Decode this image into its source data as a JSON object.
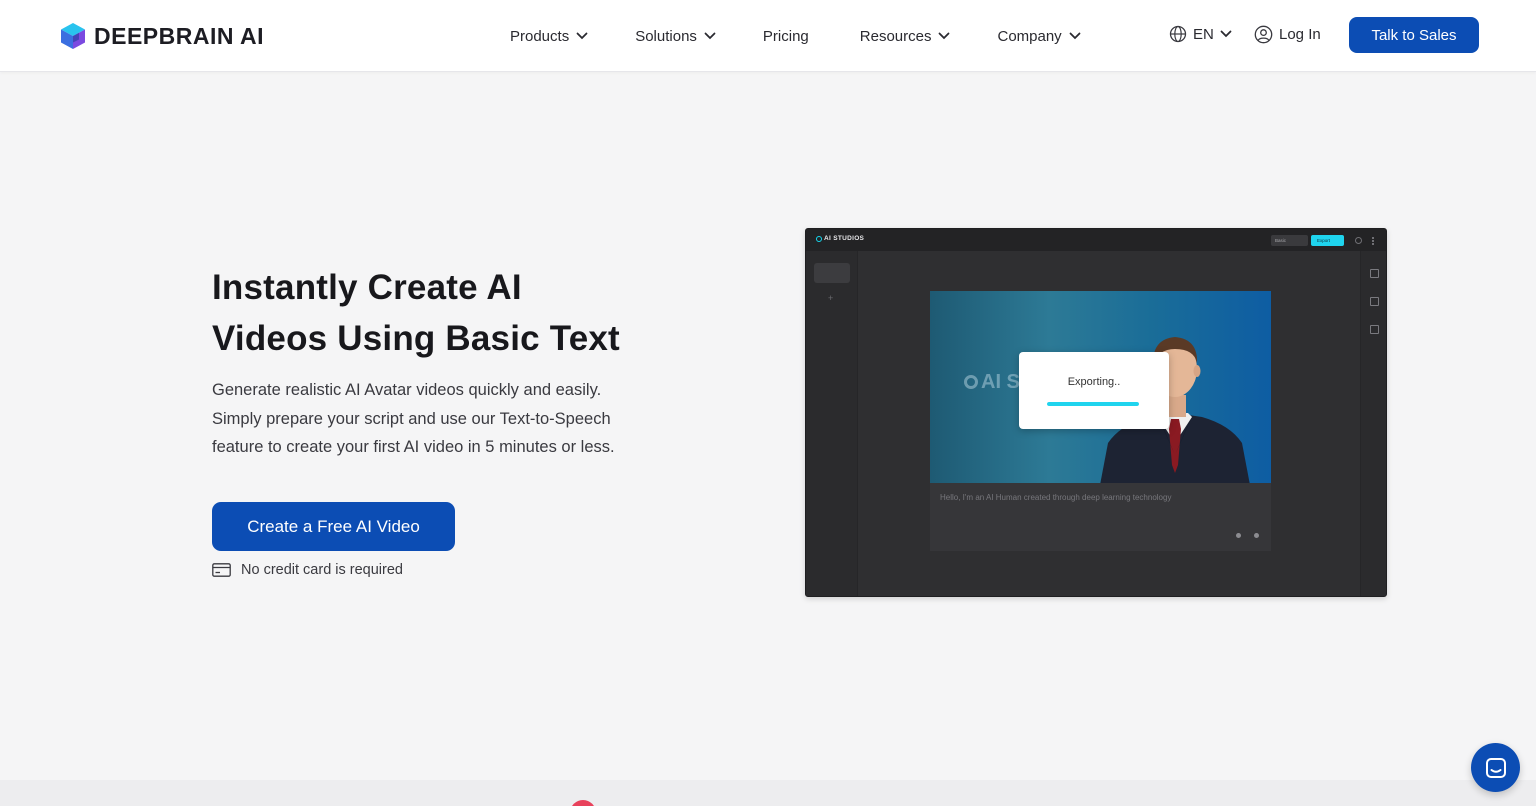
{
  "brand": {
    "name": "DEEPBRAIN AI"
  },
  "nav": {
    "items": [
      {
        "label": "Products",
        "has_dropdown": true
      },
      {
        "label": "Solutions",
        "has_dropdown": true
      },
      {
        "label": "Pricing",
        "has_dropdown": false
      },
      {
        "label": "Resources",
        "has_dropdown": true
      },
      {
        "label": "Company",
        "has_dropdown": true
      }
    ],
    "language": "EN",
    "login_label": "Log In",
    "cta_label": "Talk to Sales"
  },
  "hero": {
    "title_line1": "Instantly Create AI",
    "title_line2": "Videos Using Basic Text",
    "desc_line1": "Generate realistic AI Avatar videos quickly and easily.",
    "desc_line2": "Simply prepare your script and use our Text-to-Speech",
    "desc_line3": "feature to create your first AI video in 5 minutes or less.",
    "cta_label": "Create a Free AI Video",
    "note": "No credit card is required"
  },
  "mockup": {
    "app_name": "AI STUDIOS",
    "select_label": "Basic",
    "export_label": "Export",
    "watermark": "AI S",
    "dialog_text": "Exporting..",
    "progress": 1.0,
    "script_text": "Hello,  I'm an  AI Human created through deep learning technology"
  },
  "colors": {
    "primary": "#0c4db4",
    "accent_cyan": "#1fd4ee",
    "background": "#f5f5f6"
  },
  "icons": {
    "globe": "globe-icon",
    "user": "user-icon",
    "card": "credit-card-icon",
    "chat": "chat-icon"
  }
}
